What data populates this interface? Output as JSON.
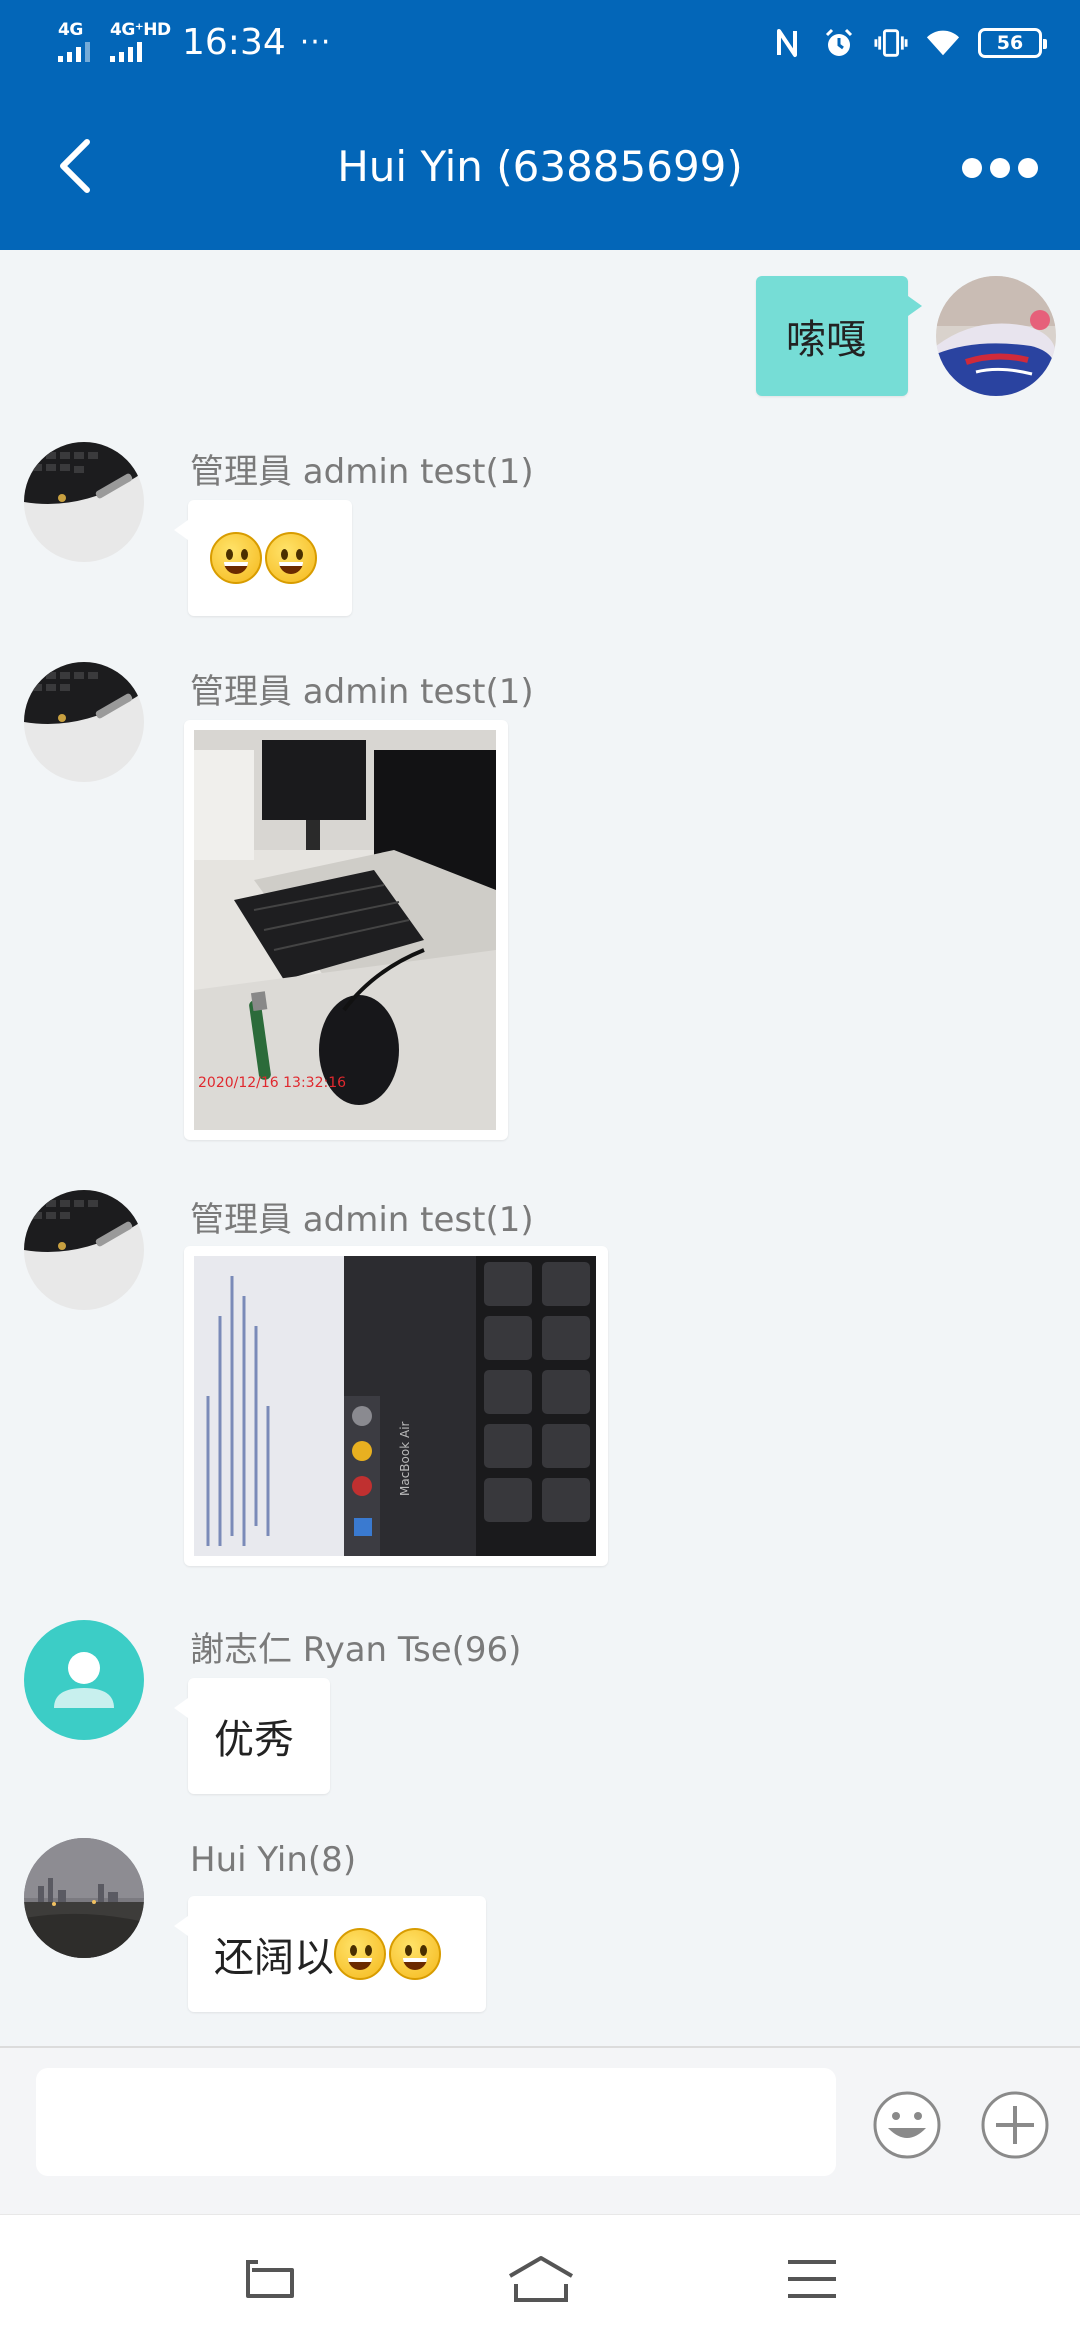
{
  "status_bar": {
    "network_1": "4G",
    "network_2": "4G⁺HD",
    "time": "16:34",
    "more": "···",
    "battery": "56",
    "icons": [
      "nfc-icon",
      "alarm-icon",
      "vibrate-icon",
      "wifi-icon",
      "battery-icon"
    ]
  },
  "header": {
    "title": "Hui Yin (63885699)",
    "back_icon": "chevron-left-icon",
    "more_icon": "more-dots-icon"
  },
  "messages": [
    {
      "sender": "",
      "outgoing": true,
      "text": "嗦嘎",
      "avatar": "sneaker-photo"
    },
    {
      "sender": "管理員 admin test(1)",
      "outgoing": false,
      "text": "",
      "emojis": 2,
      "avatar": "keyboard-photo"
    },
    {
      "sender": "管理員 admin test(1)",
      "outgoing": false,
      "type": "image",
      "image_caption": "2020/12/16 13:32:16",
      "avatar": "keyboard-photo"
    },
    {
      "sender": "管理員 admin test(1)",
      "outgoing": false,
      "type": "image",
      "image_caption": "MacBook Air",
      "avatar": "keyboard-photo"
    },
    {
      "sender": "謝志仁 Ryan Tse(96)",
      "outgoing": false,
      "text": "优秀",
      "avatar": "default-person"
    },
    {
      "sender": "Hui Yin(8)",
      "outgoing": false,
      "text": "还阔以",
      "emojis": 2,
      "avatar": "night-city-photo"
    }
  ],
  "input": {
    "placeholder": "",
    "value": ""
  },
  "colors": {
    "primary": "#0366b8",
    "outgoing_bubble": "#76ddd6",
    "background": "#f2f5f7"
  }
}
